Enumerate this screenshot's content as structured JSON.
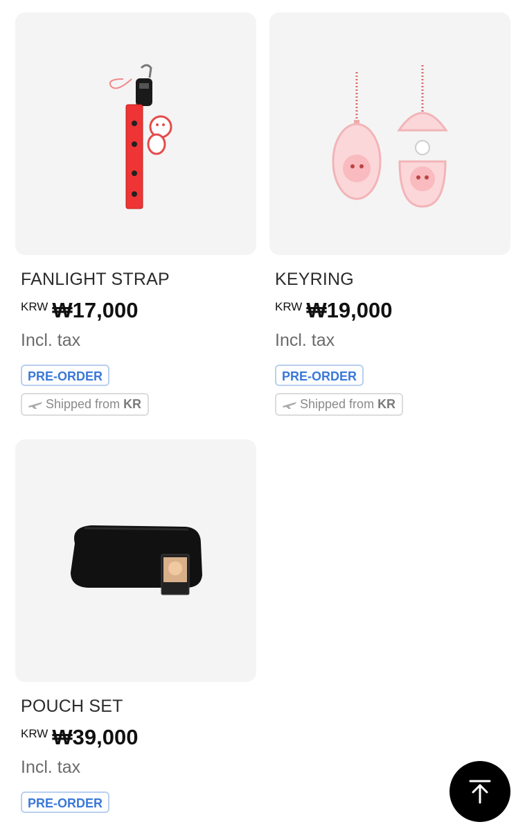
{
  "products": [
    {
      "name": "FANLIGHT STRAP",
      "currency": "KRW",
      "price": "₩17,000",
      "tax_note": "Incl. tax",
      "badge": "PRE-ORDER",
      "shipping_prefix": "Shipped from",
      "shipping_country": "KR",
      "image_icon": "fanlight-strap-image"
    },
    {
      "name": "KEYRING",
      "currency": "KRW",
      "price": "₩19,000",
      "tax_note": "Incl. tax",
      "badge": "PRE-ORDER",
      "shipping_prefix": "Shipped from",
      "shipping_country": "KR",
      "image_icon": "keyring-image"
    },
    {
      "name": "POUCH SET",
      "currency": "KRW",
      "price": "₩39,000",
      "tax_note": "Incl. tax",
      "badge": "PRE-ORDER",
      "image_icon": "pouch-set-image"
    }
  ],
  "colors": {
    "preorder_text": "#3a78d8",
    "preorder_border": "#b9cff0",
    "thumb_bg": "#f4f4f4",
    "fab_bg": "#000000"
  },
  "fab": {
    "icon": "arrow-up-to-top-icon"
  }
}
